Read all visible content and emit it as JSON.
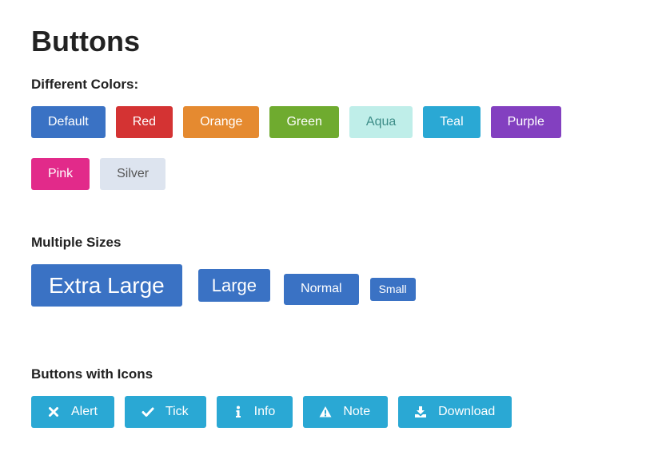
{
  "page": {
    "title": "Buttons"
  },
  "sections": {
    "colors": {
      "title": "Different Colors:",
      "buttons": [
        "Default",
        "Red",
        "Orange",
        "Green",
        "Aqua",
        "Teal",
        "Purple",
        "Pink",
        "Silver"
      ]
    },
    "sizes": {
      "title": "Multiple Sizes",
      "buttons": [
        "Extra Large",
        "Large",
        "Normal",
        "Small"
      ]
    },
    "icons": {
      "title": "Buttons with Icons",
      "buttons": [
        {
          "label": "Alert",
          "icon": "close-icon"
        },
        {
          "label": "Tick",
          "icon": "check-icon"
        },
        {
          "label": "Info",
          "icon": "info-icon"
        },
        {
          "label": "Note",
          "icon": "warning-icon"
        },
        {
          "label": "Download",
          "icon": "download-icon"
        }
      ]
    }
  },
  "colors": {
    "default": "#3a72c4",
    "red": "#d43333",
    "orange": "#e58a30",
    "green": "#6fab2f",
    "aqua": "#bfeee9",
    "teal": "#2aa8d4",
    "purple": "#8340c0",
    "pink": "#e22a8a",
    "silver": "#dde4ef"
  }
}
